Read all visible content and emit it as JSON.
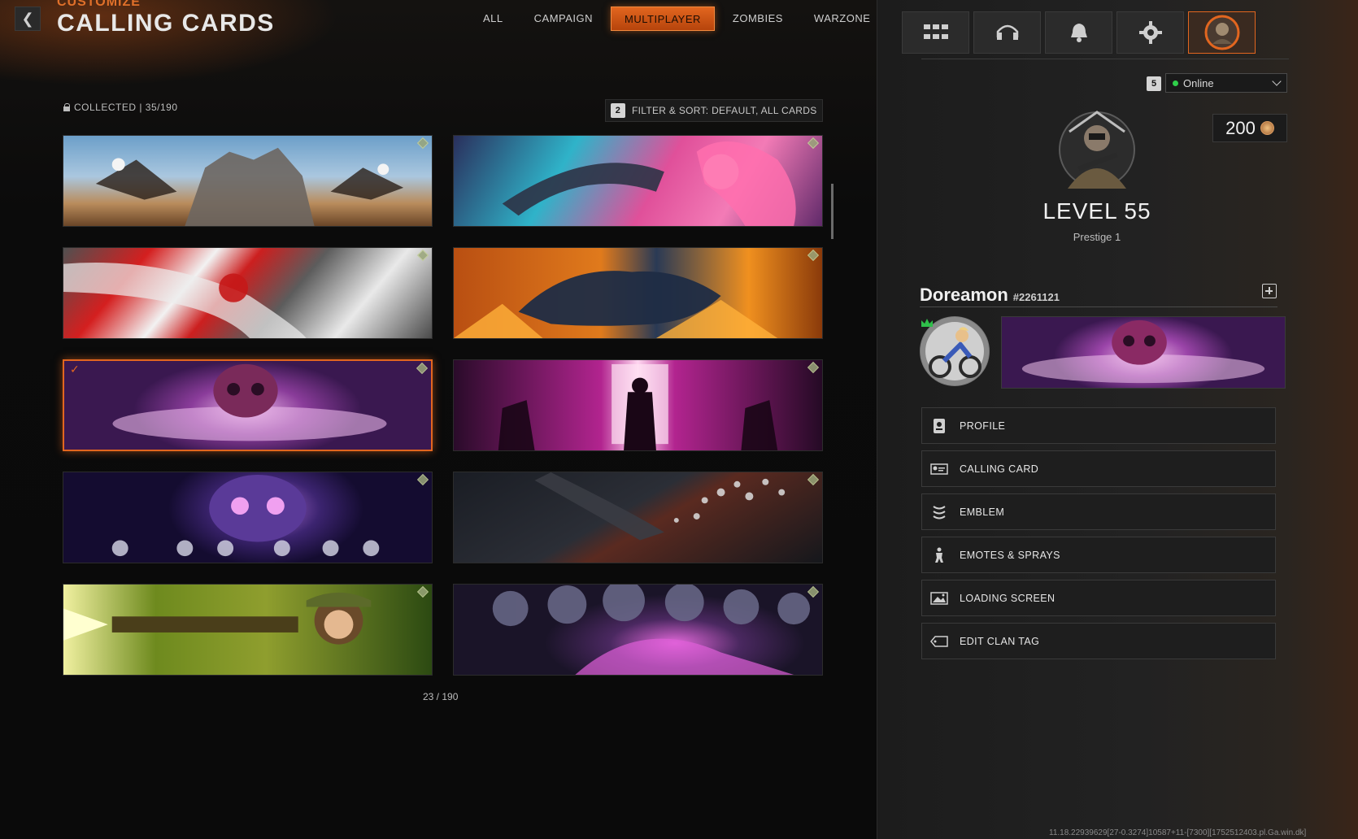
{
  "header": {
    "back_label": "❮",
    "crumb": "CUSTOMIZE",
    "title": "CALLING CARDS",
    "tabs": [
      {
        "label": "ALL"
      },
      {
        "label": "CAMPAIGN"
      },
      {
        "label": "MULTIPLAYER"
      },
      {
        "label": "ZOMBIES"
      },
      {
        "label": "WARZONE"
      }
    ],
    "active_tab": "MULTIPLAYER"
  },
  "collection": {
    "collected_label": "COLLECTED | 35/190",
    "filter_key": "2",
    "filter_label": "FILTER & SORT: DEFAULT, ALL CARDS",
    "page_count": "23 / 190"
  },
  "cards": [
    {
      "theme": "eagles-rock-golem"
    },
    {
      "theme": "anime-chainsaw-girl"
    },
    {
      "theme": "red-white-blood-splash"
    },
    {
      "theme": "fire-wolf"
    },
    {
      "theme": "melting-skull",
      "selected": true,
      "check": "✓"
    },
    {
      "theme": "samurai-red-door"
    },
    {
      "theme": "purple-skull-galaxy"
    },
    {
      "theme": "dark-hand-rocks"
    },
    {
      "theme": "monkey-with-rifle"
    },
    {
      "theme": "purple-skulls-pile"
    }
  ],
  "right_panel": {
    "top_icons": [
      "grid-icon",
      "headset-icon",
      "bell-icon",
      "gear-icon",
      "operator-avatar-icon"
    ],
    "status_key": "5",
    "status": "Online",
    "currency": "200",
    "level": "LEVEL 55",
    "prestige": "Prestige 1",
    "player_name": "Doreamon",
    "player_id": "#2261121",
    "menu": [
      {
        "label": "PROFILE",
        "icon": "profile-icon"
      },
      {
        "label": "CALLING CARD",
        "icon": "calling-card-icon"
      },
      {
        "label": "EMBLEM",
        "icon": "emblem-icon"
      },
      {
        "label": "EMOTES & SPRAYS",
        "icon": "emotes-icon"
      },
      {
        "label": "LOADING SCREEN",
        "icon": "loading-screen-icon"
      },
      {
        "label": "EDIT CLAN TAG",
        "icon": "clan-tag-icon"
      }
    ]
  },
  "debug": "11.18.22939629[27-0.3274]10587+11-[7300][1752512403.pl.Ga.win.dk]",
  "colors": {
    "accent": "#e2661f",
    "online": "#2fcf4a",
    "panel_bg": "#222222"
  }
}
